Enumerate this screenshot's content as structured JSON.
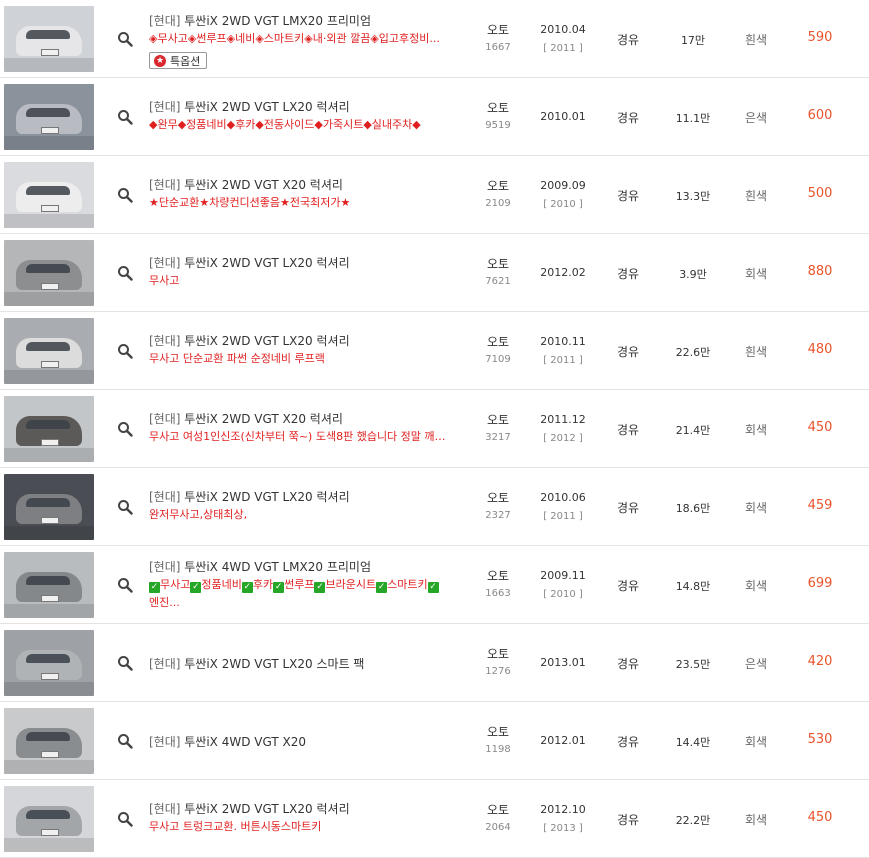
{
  "listings": [
    {
      "brand": "[현대]",
      "model": "투싼iX 2WD VGT LMX20 프리미엄",
      "desc": "◈무사고◈썬루프◈네비◈스마트키◈내·외관 깔끔◈입고후정비...",
      "badge": "특옵션",
      "trans": "오토",
      "cc": "1667",
      "date": "2010.04",
      "year": "[ 2011 ]",
      "fuel": "경유",
      "km": "17만",
      "color": "흰색",
      "price": "590",
      "body": "#e6e6e8",
      "sky": "#cfd3d8"
    },
    {
      "brand": "[현대]",
      "model": "투싼iX 2WD VGT LX20 럭셔리",
      "desc": "◆완무◆정품네비◆후카◆전동사이드◆가죽시트◆실내주차◆",
      "trans": "오토",
      "cc": "9519",
      "date": "2010.01",
      "year": "",
      "fuel": "경유",
      "km": "11.1만",
      "color": "은색",
      "price": "600",
      "body": "#b8bcc2",
      "sky": "#8a929c"
    },
    {
      "brand": "[현대]",
      "model": "투싼iX 2WD VGT X20 럭셔리",
      "desc": "★단순교환★차량컨디션좋음★전국최저가★",
      "trans": "오토",
      "cc": "2109",
      "date": "2009.09",
      "year": "[ 2010 ]",
      "fuel": "경유",
      "km": "13.3만",
      "color": "흰색",
      "price": "500",
      "body": "#ededee",
      "sky": "#d9dbde"
    },
    {
      "brand": "[현대]",
      "model": "투싼iX 2WD VGT LX20 럭셔리",
      "desc": "무사고",
      "trans": "오토",
      "cc": "7621",
      "date": "2012.02",
      "year": "",
      "fuel": "경유",
      "km": "3.9만",
      "color": "회색",
      "price": "880",
      "body": "#8c8e90",
      "sky": "#b4b6b8"
    },
    {
      "brand": "[현대]",
      "model": "투싼iX 2WD VGT LX20 럭셔리",
      "desc": "무사고 단순교환 파썬 순정네비 루프랙",
      "trans": "오토",
      "cc": "7109",
      "date": "2010.11",
      "year": "[ 2011 ]",
      "fuel": "경유",
      "km": "22.6만",
      "color": "흰색",
      "price": "480",
      "body": "#dcdcdc",
      "sky": "#a9adb2"
    },
    {
      "brand": "[현대]",
      "model": "투싼iX 2WD VGT X20 럭셔리",
      "desc": "무사고 여성1인신조(신차부터 쭉~) 도색8판 했습니다 정말 깨끗...",
      "trans": "오토",
      "cc": "3217",
      "date": "2011.12",
      "year": "[ 2012 ]",
      "fuel": "경유",
      "km": "21.4만",
      "color": "회색",
      "price": "450",
      "body": "#5c5a58",
      "sky": "#c3c6c9"
    },
    {
      "brand": "[현대]",
      "model": "투싼iX 2WD VGT LX20 럭셔리",
      "desc": "완저무사고,상태최상,",
      "trans": "오토",
      "cc": "2327",
      "date": "2010.06",
      "year": "[ 2011 ]",
      "fuel": "경유",
      "km": "18.6만",
      "color": "회색",
      "price": "459",
      "body": "#7d7f82",
      "sky": "#4a4e54"
    },
    {
      "brand": "[현대]",
      "model": "투싼iX 4WD VGT LMX20 프리미엄",
      "desc": "무사고",
      "checks": [
        "정품네비",
        "후카",
        "썬루프",
        "브라운시트",
        "스마트키"
      ],
      "more": "엔진...",
      "trans": "오토",
      "cc": "1663",
      "date": "2009.11",
      "year": "[ 2010 ]",
      "fuel": "경유",
      "km": "14.8만",
      "color": "회색",
      "price": "699",
      "body": "#85888b",
      "sky": "#b9bcbf"
    },
    {
      "brand": "[현대]",
      "model": "투싼iX 2WD VGT LX20 스마트 팩",
      "desc": "",
      "trans": "오토",
      "cc": "1276",
      "date": "2013.01",
      "year": "",
      "fuel": "경유",
      "km": "23.5만",
      "color": "은색",
      "price": "420",
      "body": "#b0b3b6",
      "sky": "#9ea2a7"
    },
    {
      "brand": "[현대]",
      "model": "투싼iX 4WD VGT X20",
      "desc": "",
      "trans": "오토",
      "cc": "1198",
      "date": "2012.01",
      "year": "",
      "fuel": "경유",
      "km": "14.4만",
      "color": "회색",
      "price": "530",
      "body": "#8a8d90",
      "sky": "#c8cacc"
    },
    {
      "brand": "[현대]",
      "model": "투싼iX 2WD VGT LX20 럭셔리",
      "desc": "무사고 트렁크교환. 버튼시동스마트키",
      "trans": "오토",
      "cc": "2064",
      "date": "2012.10",
      "year": "[ 2013 ]",
      "fuel": "경유",
      "km": "22.2만",
      "color": "회색",
      "price": "450",
      "body": "#a3a6a9",
      "sky": "#d4d6d9"
    }
  ]
}
